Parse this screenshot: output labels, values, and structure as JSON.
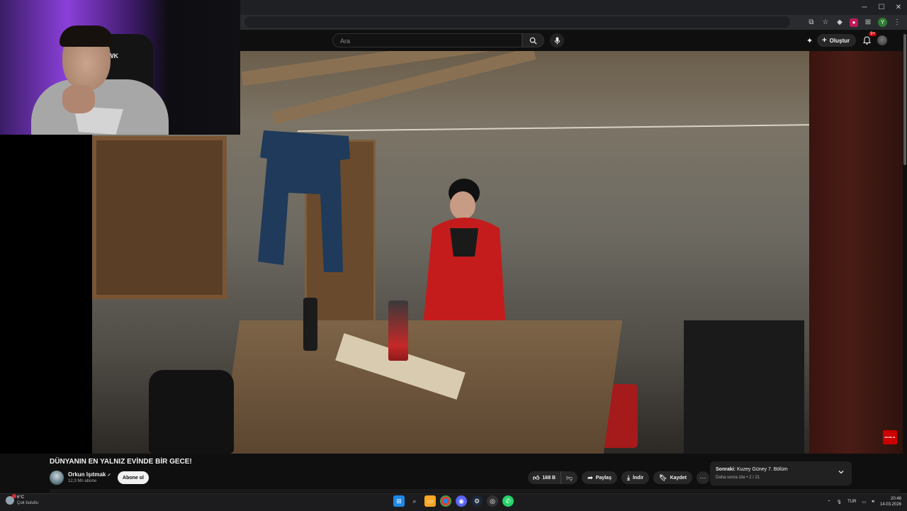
{
  "browser": {
    "window_controls": [
      "minimize",
      "maximize",
      "close"
    ],
    "profile_letter": "Y"
  },
  "masthead": {
    "search_placeholder": "Ara",
    "create_label": "Oluştur",
    "notification_count": "9+"
  },
  "video": {
    "title": "DÜNYANIN EN YALNIZ EVİNDE BİR GECE!",
    "channel_name": "Orkun Işıtmak",
    "verified": "✔",
    "subscribers": "12,3 Mn abone",
    "subscribe_label": "Abone ol",
    "overlay_label": "ABONE OL"
  },
  "actions": {
    "likes": "168 B",
    "share_label": "Paylaş",
    "download_label": "İndir",
    "save_label": "Kaydet",
    "more_label": "···"
  },
  "next_up": {
    "prefix": "Sonraki:",
    "title": "Kuzey Güney 7. Bölüm",
    "subtitle": "Daha sonra izle • 2 / 21"
  },
  "webcam": {
    "chair_logo": "WK"
  },
  "taskbar": {
    "weather_temp": "6°C",
    "weather_desc": "Çok bulutlu",
    "language": "TUR",
    "time": "20:46",
    "date": "14.03.2026"
  },
  "colors": {
    "yt_bg": "#0f0f0f",
    "pill_bg": "#272727",
    "subscribe_bg": "#f1f1f1",
    "accent_red": "#cc0000"
  }
}
